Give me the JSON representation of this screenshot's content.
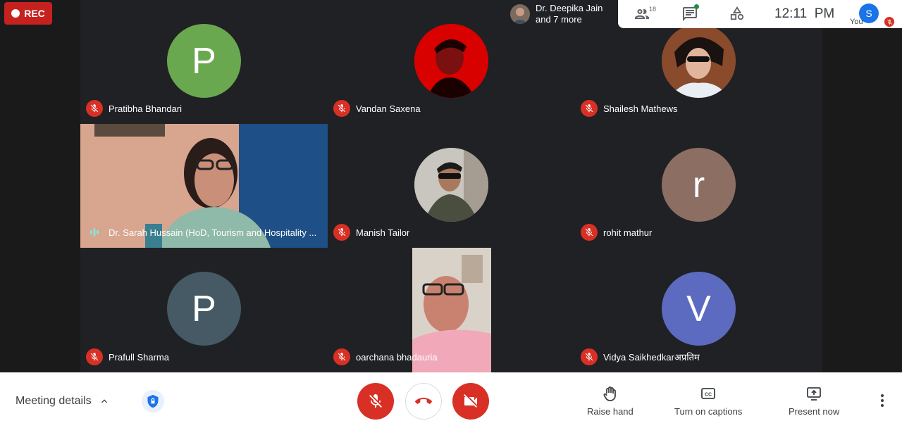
{
  "recording": {
    "label": "REC"
  },
  "presenter": {
    "name": "Dr. Deepika Jain",
    "more": "and 7 more"
  },
  "topbar": {
    "participant_count": "18",
    "time": "12:11  PM",
    "self_label": "You",
    "self_initial": "S"
  },
  "tiles": [
    {
      "name": "Pratibha Bhandari",
      "initial": "P",
      "color": "#6aa84f"
    },
    {
      "name": "Vandan Saxena"
    },
    {
      "name": "Shailesh Mathews"
    },
    {
      "name": "Dr. Sarah Hussain (HoD, Tourism and Hospitality ..."
    },
    {
      "name": "Manish Tailor"
    },
    {
      "name": "rohit mathur",
      "initial": "r",
      "color": "#8d6e63"
    },
    {
      "name": "Prafull Sharma",
      "initial": "P",
      "color": "#455a64"
    },
    {
      "name": "oarchana bhadauria"
    },
    {
      "name": "Vidya Saikhedkarअप्रतिम",
      "initial": "V",
      "color": "#5c6bc0"
    }
  ],
  "bottom": {
    "meeting_details": "Meeting details",
    "raise_hand": "Raise hand",
    "captions": "Turn on captions",
    "present": "Present now"
  },
  "colors": {
    "danger": "#d93025",
    "accent": "#1a73e8"
  }
}
